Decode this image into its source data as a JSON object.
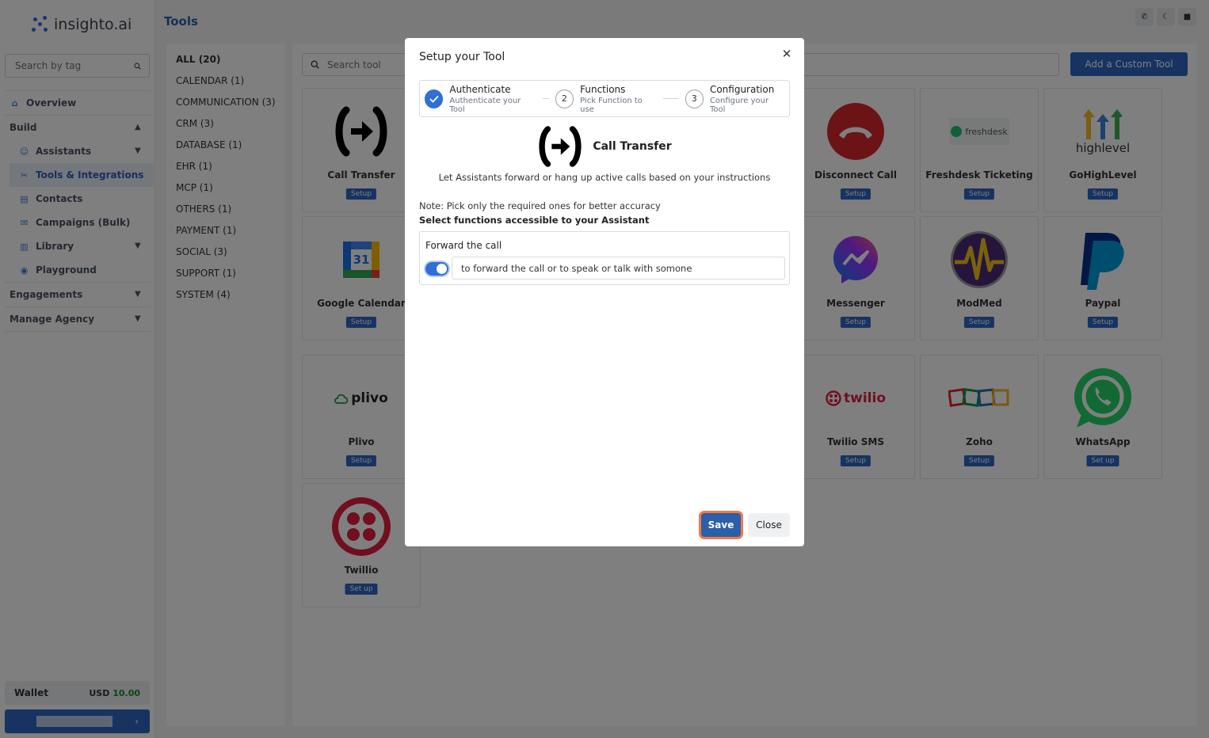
{
  "app": {
    "brand": "insighto.ai",
    "page_title": "Tools"
  },
  "sidebar": {
    "search_placeholder": "Search by tag",
    "nav": {
      "overview": "Overview",
      "build": "Build",
      "assistants": "Assistants",
      "tools": "Tools & Integrations",
      "contacts": "Contacts",
      "campaigns": "Campaigns (Bulk)",
      "library": "Library",
      "playground": "Playground",
      "engagements": "Engagements",
      "manage_agency": "Manage Agency"
    },
    "wallet": {
      "label": "Wallet",
      "currency": "USD",
      "amount": "10.00"
    }
  },
  "categories": [
    "ALL (20)",
    "CALENDAR (1)",
    "COMMUNICATION (3)",
    "CRM (3)",
    "DATABASE (1)",
    "EHR (1)",
    "MCP (1)",
    "OTHERS (1)",
    "PAYMENT (1)",
    "SOCIAL (3)",
    "SUPPORT (1)",
    "SYSTEM (4)"
  ],
  "tools_panel": {
    "search_placeholder": "Search tool",
    "add_custom_label": "Add a Custom Tool",
    "cards": [
      {
        "name": "Call Transfer",
        "badge": "Setup"
      },
      {
        "name": "Disconnect Call",
        "badge": "Setup"
      },
      {
        "name": "Freshdesk Ticketing",
        "badge": "Setup",
        "logo_text": "freshdesk"
      },
      {
        "name": "GoHighLevel",
        "badge": "Setup",
        "logo_text": "highlevel"
      },
      {
        "name": "Google Calendar",
        "badge": "Setup",
        "logo_text": "31"
      },
      {
        "name": "Messenger",
        "badge": "Setup"
      },
      {
        "name": "ModMed",
        "badge": "Setup"
      },
      {
        "name": "Paypal",
        "badge": "Setup"
      },
      {
        "name": "Plivo",
        "badge": "Setup",
        "logo_text": "plivo"
      },
      {
        "name": "Twilio SMS",
        "badge": "Setup",
        "logo_text": "twilio"
      },
      {
        "name": "Zoho",
        "badge": "Setup"
      },
      {
        "name": "WhatsApp",
        "badge": "Set up"
      },
      {
        "name": "Twillio",
        "badge": "Set up"
      }
    ]
  },
  "modal": {
    "title": "Setup your Tool",
    "steps": [
      {
        "marker": "",
        "title": "Authenticate",
        "subtitle": "Authenticate your Tool"
      },
      {
        "marker": "2",
        "title": "Functions",
        "subtitle": "Pick Function to use"
      },
      {
        "marker": "3",
        "title": "Configuration",
        "subtitle": "Configure your Tool"
      }
    ],
    "tool_name": "Call Transfer",
    "tool_description": "Let Assistants forward or hang up active calls based on your instructions",
    "note": "Note: Pick only the required ones for better accuracy",
    "select_label": "Select functions accessible to your Assistant",
    "function": {
      "title": "Forward the call",
      "enabled": true,
      "instruction": "to forward the call or to speak or talk with somone"
    },
    "save_label": "Save",
    "close_label": "Close"
  },
  "colors": {
    "primary": "#2c66c3",
    "accent_focus": "#f07a4c",
    "wallet_amount": "#1c8a2f"
  }
}
